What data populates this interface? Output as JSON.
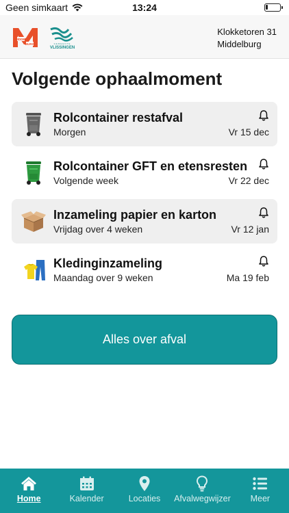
{
  "status": {
    "carrier": "Geen simkaart",
    "time": "13:24",
    "battery_level": 0.15
  },
  "header": {
    "logo_middelburg_text": "MIDDEL BURG",
    "logo_vlissingen_text": "VLISSINGEN",
    "address_line1": "Klokketoren 31",
    "address_line2": "Middelburg"
  },
  "main": {
    "section_title": "Volgende ophaalmoment",
    "items": [
      {
        "title": "Rolcontainer restafval",
        "when": "Morgen",
        "date": "Vr 15 dec",
        "icon": "grey-bin-icon"
      },
      {
        "title": "Rolcontainer GFT en etensresten",
        "when": "Volgende week",
        "date": "Vr 22 dec",
        "icon": "green-bin-icon"
      },
      {
        "title": "Inzameling papier en karton",
        "when": "Vrijdag over 4 weken",
        "date": "Vr 12 jan",
        "icon": "cardboard-box-icon"
      },
      {
        "title": "Kledinginzameling",
        "when": "Maandag over 9 weken",
        "date": "Ma 19 feb",
        "icon": "clothing-icon"
      }
    ],
    "cta_label": "Alles over afval"
  },
  "tabbar": {
    "tabs": [
      {
        "label": "Home",
        "icon": "home-icon",
        "active": true
      },
      {
        "label": "Kalender",
        "icon": "calendar-icon",
        "active": false
      },
      {
        "label": "Locaties",
        "icon": "location-pin-icon",
        "active": false
      },
      {
        "label": "Afvalwegwijzer",
        "icon": "lightbulb-icon",
        "active": false
      },
      {
        "label": "Meer",
        "icon": "list-icon",
        "active": false
      }
    ]
  },
  "colors": {
    "accent": "#14969b",
    "card_bg": "#efefef",
    "logo_red": "#e8502a",
    "logo_teal": "#1a8f8d"
  }
}
